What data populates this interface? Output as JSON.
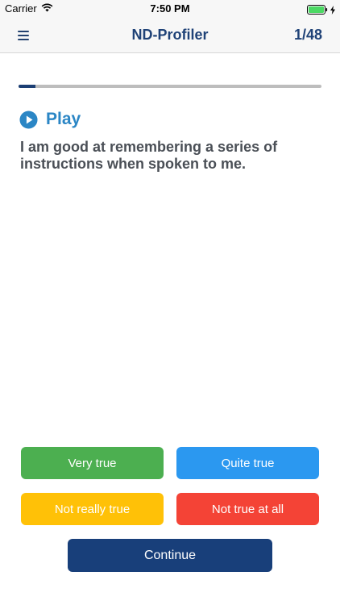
{
  "status_bar": {
    "carrier": "Carrier",
    "time": "7:50 PM",
    "battery_level_percent": 100
  },
  "nav": {
    "title": "ND-Profiler",
    "counter": "1/48",
    "menu_icon": "hamburger-menu-icon"
  },
  "progress": {
    "current": 1,
    "total": 48
  },
  "play": {
    "label": "Play",
    "icon": "play-circle-icon",
    "color": "#2b86c5"
  },
  "question": {
    "text": "I am good at remembering a series of instructions when spoken to me."
  },
  "answers": [
    {
      "label": "Very true",
      "color": "#4caf50"
    },
    {
      "label": "Quite true",
      "color": "#2b98f0"
    },
    {
      "label": "Not really true",
      "color": "#ffc107"
    },
    {
      "label": "Not true at all",
      "color": "#f44336"
    }
  ],
  "continue": {
    "label": "Continue",
    "color": "#183f7a"
  }
}
